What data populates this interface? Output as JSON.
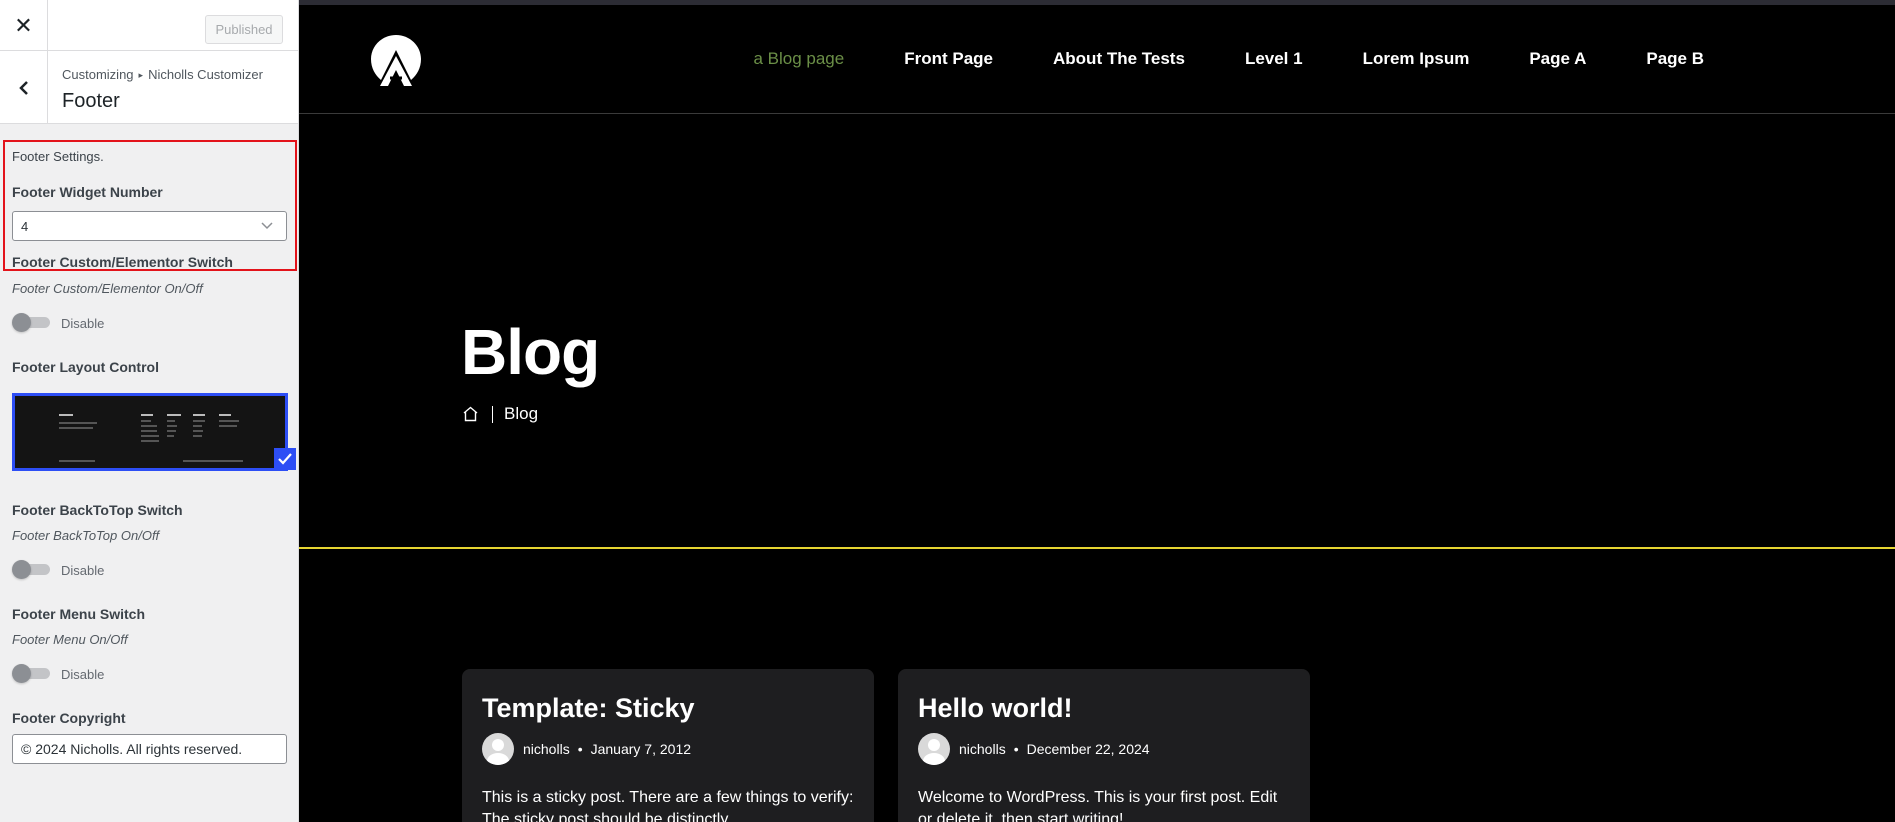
{
  "customizer": {
    "close_icon": "close-icon",
    "publish_label": "Published",
    "breadcrumb_root": "Customizing",
    "breadcrumb_sep": "▸",
    "breadcrumb_panel": "Nicholls Customizer",
    "section_title": "Footer",
    "settings_heading": "Footer Settings.",
    "widget_number": {
      "label": "Footer Widget Number",
      "value": "4"
    },
    "elementor_switch": {
      "label": "Footer Custom/Elementor Switch",
      "description": "Footer Custom/Elementor On/Off",
      "state": "Disable"
    },
    "layout_control": {
      "label": "Footer Layout Control"
    },
    "backtotop_switch": {
      "label": "Footer BackToTop Switch",
      "description": "Footer BackToTop On/Off",
      "state": "Disable"
    },
    "menu_switch": {
      "label": "Footer Menu Switch",
      "description": "Footer Menu On/Off",
      "state": "Disable"
    },
    "copyright": {
      "label": "Footer Copyright",
      "value": "© 2024 Nicholls. All rights reserved."
    },
    "highlight_color": "#e3131b",
    "accent_color": "#2d4ef5"
  },
  "site": {
    "nav": [
      {
        "label": "a Blog page",
        "active": true
      },
      {
        "label": "Front Page",
        "active": false
      },
      {
        "label": "About The Tests",
        "active": false
      },
      {
        "label": "Level 1",
        "active": false
      },
      {
        "label": "Lorem Ipsum",
        "active": false
      },
      {
        "label": "Page A",
        "active": false
      },
      {
        "label": "Page B",
        "active": false
      }
    ],
    "hero": {
      "title": "Blog",
      "breadcrumb": "Blog"
    },
    "posts": [
      {
        "title": "Template: Sticky",
        "author": "nicholls",
        "date": "January 7, 2012",
        "excerpt": "This is a sticky post. There are a few things to verify: The sticky post should be distinctly"
      },
      {
        "title": "Hello world!",
        "author": "nicholls",
        "date": "December 22, 2024",
        "excerpt": "Welcome to WordPress. This is your first post. Edit or delete it, then start writing!"
      }
    ],
    "active_nav_color": "#6b8f47",
    "divider_color": "#e6d531"
  }
}
